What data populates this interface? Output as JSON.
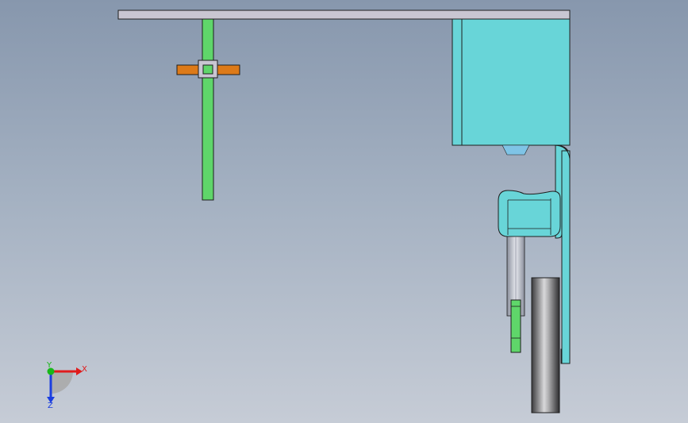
{
  "viewport": {
    "background_top": "#8797ad",
    "background_bottom": "#c6ccd6"
  },
  "model": {
    "colors": {
      "plate": "#c9c6d2",
      "cyan_body": "#68d5d8",
      "green_part": "#5fd66a",
      "orange_part": "#dd7a18",
      "wheel": "#9a9a9c",
      "rod": "#b8bcc6",
      "outline": "#1e1e1e"
    }
  },
  "triad": {
    "x_label": "X",
    "y_label": "Y",
    "z_label": "Z",
    "x_color": "#e01b1b",
    "y_color": "#18b818",
    "z_color": "#1b3ee0"
  }
}
